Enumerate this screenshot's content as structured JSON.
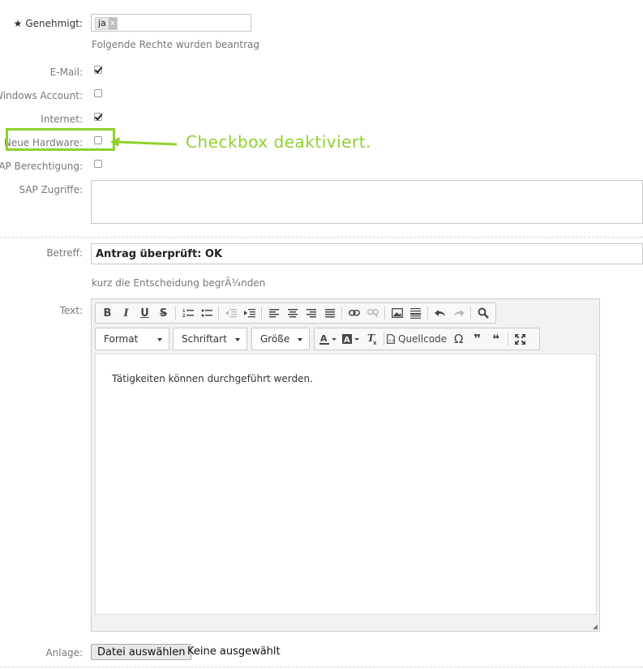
{
  "genehmigt": {
    "label": "Genehmigt:",
    "required_marker": "★",
    "tag": "ja",
    "tag_remove": "x"
  },
  "rights_hint": "Folgende Rechte wurden beantrag",
  "rights": [
    {
      "label": "E-Mail:",
      "checked": true
    },
    {
      "label": "Windows Account:",
      "checked": false
    },
    {
      "label": "Internet:",
      "checked": true
    },
    {
      "label": "Neue Hardware:",
      "checked": false
    },
    {
      "label": "SAP Berechtigung:",
      "checked": false
    }
  ],
  "sap_zugriffe": {
    "label": "SAP Zugriffe:",
    "value": ""
  },
  "annotation": {
    "text": "Checkbox deaktiviert.",
    "color": "#8ed12d"
  },
  "betreff": {
    "label": "Betreff:",
    "value": "Antrag überprüft: OK",
    "hint": "kurz die Entscheidung begrÃ¼nden"
  },
  "text_editor": {
    "label": "Text:",
    "toolbar_row1": [
      "bold-icon",
      "italic-icon",
      "underline-icon",
      "strikethrough-icon",
      "numbered-list-icon",
      "bulleted-list-icon",
      "outdent-icon",
      "indent-icon",
      "align-left-icon",
      "align-center-icon",
      "align-right-icon",
      "justify-icon",
      "link-icon",
      "unlink-icon",
      "image-icon",
      "horizontal-line-icon",
      "undo-icon",
      "redo-icon",
      "find-icon"
    ],
    "format": "Format",
    "font": "Schriftart",
    "size": "Größe",
    "source_label": "Quellcode",
    "content": "Tätigkeiten können durchgeführt werden."
  },
  "anlage": {
    "label": "Anlage:",
    "button": "Datei auswählen",
    "status": "Keine ausgewählt"
  }
}
